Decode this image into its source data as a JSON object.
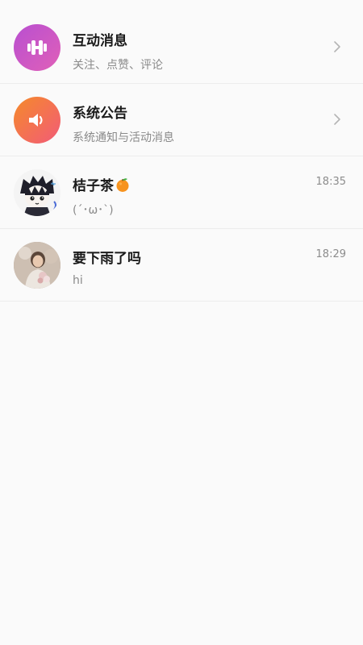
{
  "messages": [
    {
      "kind": "system",
      "title": "互动消息",
      "subtitle": "关注、点赞、评论",
      "icon": "dumbbell-icon",
      "accent": "#c657cf"
    },
    {
      "kind": "system",
      "title": "系统公告",
      "subtitle": "系统通知与活动消息",
      "icon": "speaker-icon",
      "accent": "#f4733f"
    },
    {
      "kind": "chat",
      "title": "桔子茶",
      "title_emoji": "tangerine-icon",
      "subtitle": "(´･ω･`)",
      "time": "18:35"
    },
    {
      "kind": "chat",
      "title": "要下雨了吗",
      "subtitle": "hi",
      "time": "18:29"
    }
  ],
  "colors": {
    "background": "#fafafa",
    "divider": "#ececec",
    "title_text": "#1a1a1a",
    "secondary_text": "#8a8a8a"
  }
}
